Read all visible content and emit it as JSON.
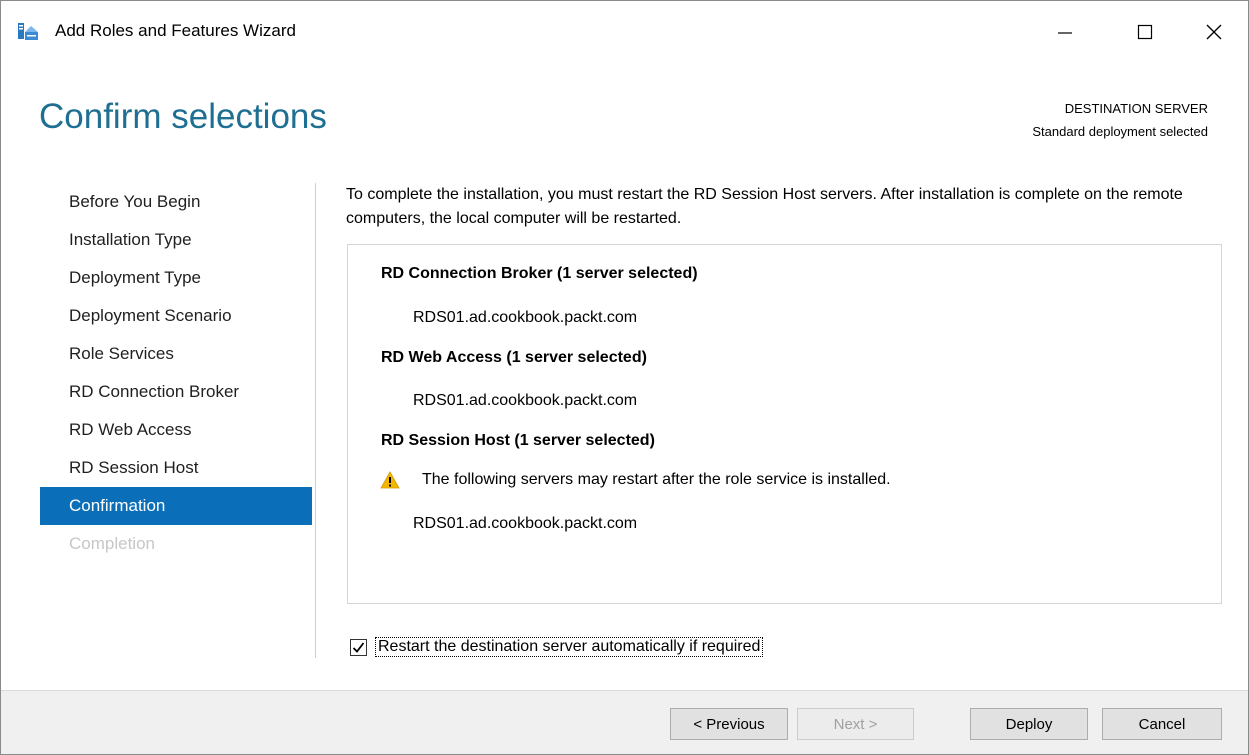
{
  "window": {
    "title": "Add Roles and Features Wizard",
    "icons": [
      "server-manager-icon",
      "minimize-icon",
      "maximize-icon",
      "close-icon"
    ]
  },
  "header": {
    "page_title": "Confirm selections",
    "destination_label": "DESTINATION SERVER",
    "destination_value": "Standard deployment selected"
  },
  "nav": {
    "items": [
      {
        "label": "Before You Begin",
        "state": "normal"
      },
      {
        "label": "Installation Type",
        "state": "normal"
      },
      {
        "label": "Deployment Type",
        "state": "normal"
      },
      {
        "label": "Deployment Scenario",
        "state": "normal"
      },
      {
        "label": "Role Services",
        "state": "normal"
      },
      {
        "label": "RD Connection Broker",
        "state": "normal"
      },
      {
        "label": "RD Web Access",
        "state": "normal"
      },
      {
        "label": "RD Session Host",
        "state": "normal"
      },
      {
        "label": "Confirmation",
        "state": "active"
      },
      {
        "label": "Completion",
        "state": "disabled"
      }
    ]
  },
  "content": {
    "intro": "To complete the installation, you must restart the RD Session Host servers. After installation is complete on the remote computers, the local computer will be restarted.",
    "sections": [
      {
        "heading": "RD Connection Broker  (1 server selected)",
        "server": "RDS01.ad.cookbook.packt.com"
      },
      {
        "heading": "RD Web Access  (1 server selected)",
        "server": "RDS01.ad.cookbook.packt.com"
      },
      {
        "heading": "RD Session Host  (1 server selected)",
        "warning": "The following servers may restart after the role service is installed.",
        "server": "RDS01.ad.cookbook.packt.com"
      }
    ],
    "restart_checkbox": {
      "label": "Restart the destination server automatically if required",
      "checked": true
    }
  },
  "footer": {
    "previous_label": "< Previous",
    "next_label": "Next >",
    "deploy_label": "Deploy",
    "cancel_label": "Cancel"
  },
  "colors": {
    "title_accent": "#1e6f92",
    "nav_active_bg": "#0a6eb9",
    "warning": "#f2b600"
  }
}
